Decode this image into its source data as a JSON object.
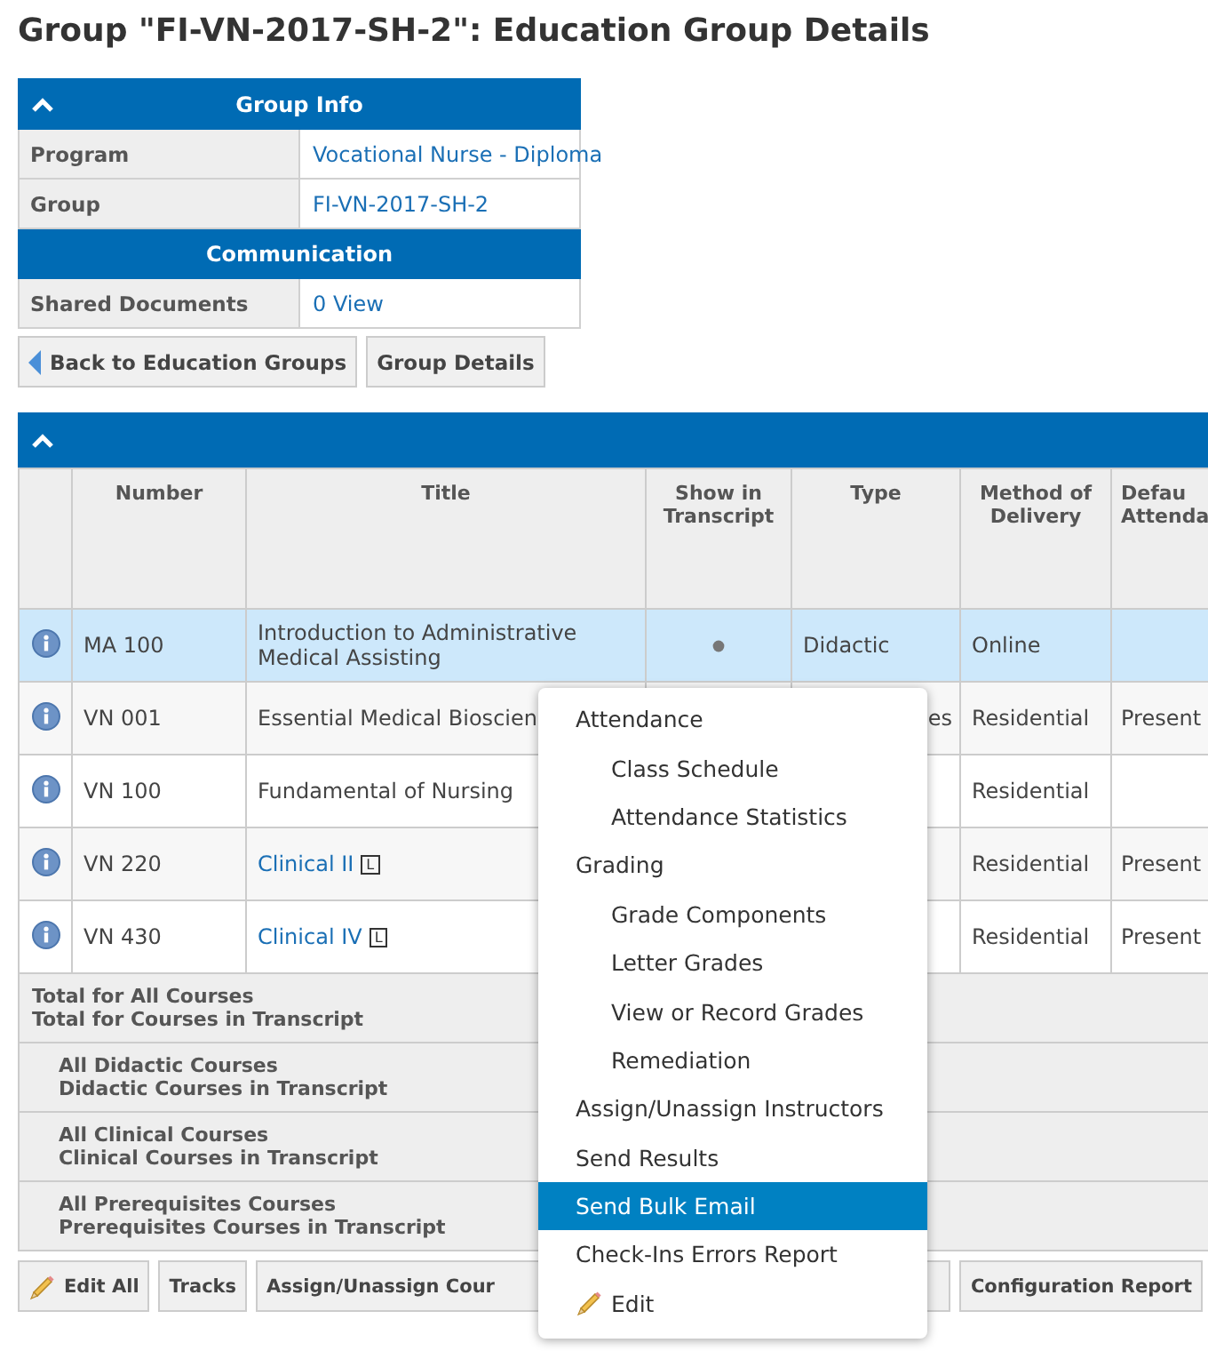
{
  "title": "Group \"FI-VN-2017-SH-2\": Education Group Details",
  "group_info": {
    "sections": [
      {
        "header": "Group Info",
        "collapsible": true,
        "rows": [
          {
            "label": "Program",
            "value": "Vocational Nurse - Diploma"
          },
          {
            "label": "Group",
            "value": "FI-VN-2017-SH-2"
          }
        ]
      },
      {
        "header": "Communication",
        "collapsible": false,
        "rows": [
          {
            "label": "Shared Documents",
            "value": "0 View"
          }
        ]
      }
    ]
  },
  "top_buttons": [
    {
      "label": "Back to Education Groups"
    },
    {
      "label": "Group Details"
    }
  ],
  "courses": {
    "columns": [
      "",
      "Number",
      "Title",
      "Show in Transcript",
      "Type",
      "Method of Delivery",
      "Defau Attenda"
    ],
    "rows": [
      {
        "number": "MA 100",
        "title": "Introduction to Administrative Medical Assisting",
        "link": false,
        "show_in_transcript": true,
        "type": "Didactic",
        "method": "Online",
        "selected": true
      },
      {
        "number": "VN 001",
        "title": "Essential Medical Bioscien",
        "link": false,
        "type": "es",
        "method": "Residential",
        "default_attendance": "Present",
        "selected": false
      },
      {
        "number": "VN 100",
        "title": "Fundamental of Nursing",
        "link": false,
        "method": "Residential",
        "selected": false
      },
      {
        "number": "VN 220",
        "title": "Clinical II",
        "link": true,
        "badge": "L",
        "method": "Residential",
        "default_attendance": "Present",
        "selected": false
      },
      {
        "number": "VN 430",
        "title": "Clinical IV",
        "link": true,
        "badge": "L",
        "method": "Residential",
        "default_attendance": "Present",
        "selected": false
      }
    ],
    "totals": [
      {
        "lines": [
          "Total for All Courses",
          "Total for Courses in Transcript"
        ],
        "indented": false
      },
      {
        "lines": [
          "All Didactic Courses",
          "Didactic Courses in Transcript"
        ],
        "indented": true
      },
      {
        "lines": [
          "All Clinical Courses",
          "Clinical Courses in Transcript"
        ],
        "indented": true
      },
      {
        "lines": [
          "All Prerequisites Courses",
          "Prerequisites Courses in Transcript"
        ],
        "indented": true
      }
    ],
    "buttons": [
      {
        "label": "Edit All"
      },
      {
        "label": "Tracks"
      },
      {
        "label": "Assign/Unassign Cour"
      },
      {
        "label": "Configuration Report"
      }
    ]
  },
  "context_menu": {
    "items": [
      {
        "label": "Attendance",
        "kind": "group",
        "selected": false
      },
      {
        "label": "Class Schedule",
        "kind": "sub",
        "selected": false
      },
      {
        "label": "Attendance Statistics",
        "kind": "sub",
        "selected": false
      },
      {
        "label": "Grading",
        "kind": "group",
        "selected": false
      },
      {
        "label": "Grade Components",
        "kind": "sub",
        "selected": false
      },
      {
        "label": "Letter Grades",
        "kind": "sub",
        "selected": false
      },
      {
        "label": "View or Record Grades",
        "kind": "sub",
        "selected": false
      },
      {
        "label": "Remediation",
        "kind": "sub",
        "selected": false
      },
      {
        "label": "Assign/Unassign Instructors",
        "kind": "group",
        "selected": false
      },
      {
        "label": "Send Results",
        "kind": "group",
        "selected": false
      },
      {
        "label": "Send Bulk Email",
        "kind": "group",
        "selected": true
      },
      {
        "label": "Check-Ins Errors Report",
        "kind": "group",
        "selected": false
      },
      {
        "label": "Edit",
        "kind": "edit",
        "selected": false
      }
    ]
  }
}
